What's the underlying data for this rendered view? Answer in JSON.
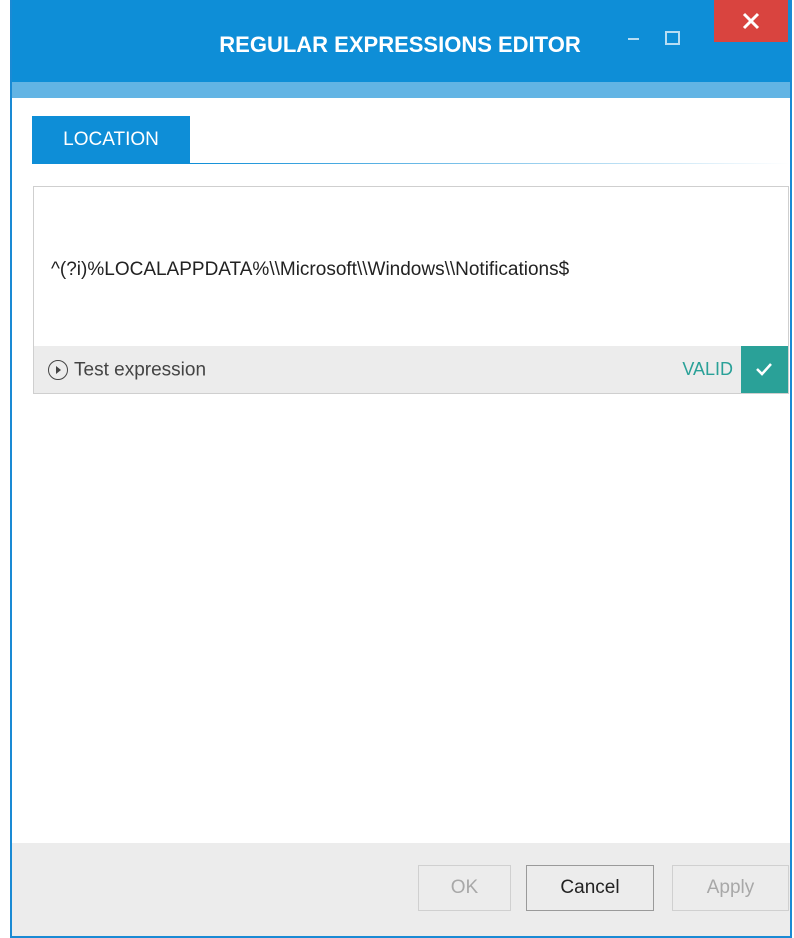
{
  "window": {
    "title": "REGULAR EXPRESSIONS EDITOR"
  },
  "tabs": [
    {
      "label": "LOCATION",
      "active": true
    }
  ],
  "editor": {
    "expression": "^(?i)%LOCALAPPDATA%\\\\Microsoft\\\\Windows\\\\Notifications$",
    "test_label": "Test expression",
    "status": "VALID"
  },
  "footer": {
    "ok_label": "OK",
    "cancel_label": "Cancel",
    "apply_label": "Apply"
  },
  "colors": {
    "title_bar": "#0e8ed7",
    "close_button": "#d9443f",
    "valid": "#2aa198"
  },
  "icons": {
    "close": "close-icon",
    "minimize": "minimize-icon",
    "maximize": "maximize-icon",
    "play": "play-circle-icon",
    "check": "checkmark-icon"
  }
}
